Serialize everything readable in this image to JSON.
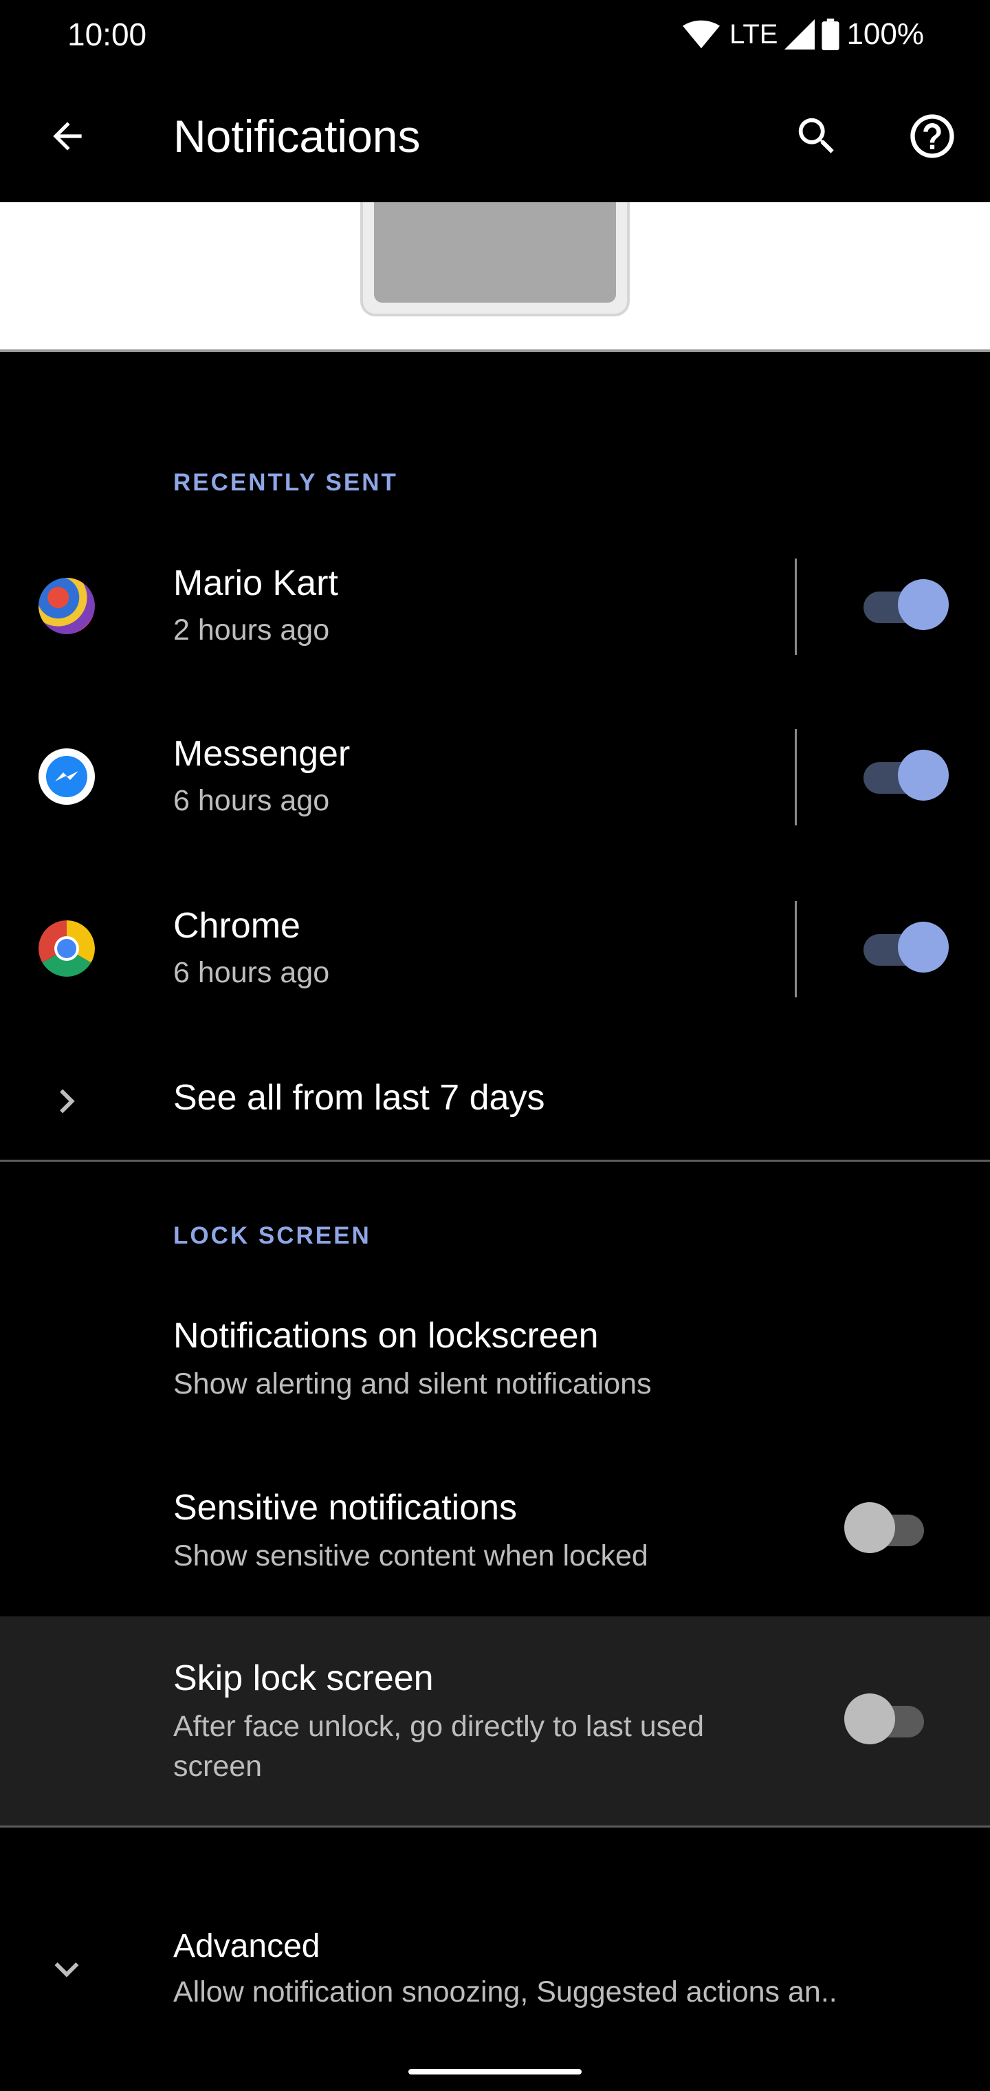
{
  "status_bar": {
    "time": "10:00",
    "network": "LTE",
    "battery": "100%"
  },
  "app_bar": {
    "title": "Notifications",
    "back_icon": "arrow-back-icon",
    "search_icon": "search-icon",
    "help_icon": "help-icon"
  },
  "recently_sent": {
    "header": "RECENTLY SENT",
    "items": [
      {
        "name": "Mario Kart",
        "time": "2 hours ago",
        "icon": "mario-kart-app-icon",
        "enabled": true
      },
      {
        "name": "Messenger",
        "time": "6 hours ago",
        "icon": "messenger-app-icon",
        "enabled": true
      },
      {
        "name": "Chrome",
        "time": "6 hours ago",
        "icon": "chrome-app-icon",
        "enabled": true
      }
    ],
    "see_all": "See all from last 7 days"
  },
  "lock_screen": {
    "header": "LOCK SCREEN",
    "notifications_on_lockscreen": {
      "title": "Notifications on lockscreen",
      "subtitle": "Show alerting and silent notifications"
    },
    "sensitive": {
      "title": "Sensitive notifications",
      "subtitle": "Show sensitive content when locked",
      "enabled": false
    },
    "skip_lock": {
      "title": "Skip lock screen",
      "subtitle_line1": "After face unlock, go directly to last used",
      "subtitle_line2": "screen",
      "enabled": false
    }
  },
  "advanced": {
    "title": "Advanced",
    "subtitle": "Allow notification snoozing, Suggested actions an.."
  },
  "colors": {
    "accent": "#8ea6e6",
    "background": "#000000",
    "highlight_row": "#1f1f1f"
  }
}
